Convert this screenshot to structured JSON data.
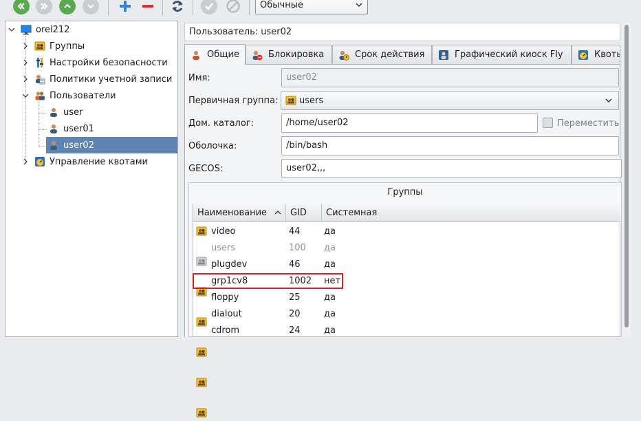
{
  "toolbar": {
    "view_mode": "Обычные",
    "icons": [
      "first-icon",
      "back-icon",
      "up-icon",
      "down-icon",
      "add-icon",
      "remove-icon",
      "refresh-icon",
      "apply-icon",
      "cancel-icon"
    ]
  },
  "tree": {
    "root": "orel212",
    "items": [
      {
        "label": "Группы",
        "icon": "group-icon"
      },
      {
        "label": "Настройки безопасности",
        "icon": "security-settings-icon"
      },
      {
        "label": "Политики учетной записи",
        "icon": "account-policy-icon"
      },
      {
        "label": "Пользователи",
        "icon": "users-icon"
      },
      {
        "label": "user",
        "icon": "user-icon"
      },
      {
        "label": "user01",
        "icon": "user-icon"
      },
      {
        "label": "user02",
        "icon": "user-icon"
      },
      {
        "label": "Управление квотами",
        "icon": "quota-icon"
      }
    ],
    "selected": "user02"
  },
  "header": {
    "user_title": "Пользователь: user02"
  },
  "tabs": [
    {
      "label": "Общие"
    },
    {
      "label": "Блокировка"
    },
    {
      "label": "Срок действия"
    },
    {
      "label": "Графический киоск Fly"
    },
    {
      "label": "Квоты"
    }
  ],
  "form": {
    "name_label": "Имя:",
    "name_value": "user02",
    "primary_group_label": "Первичная группа:",
    "primary_group_value": "users",
    "home_label": "Дом. каталог:",
    "home_value": "/home/user02",
    "move_label": "Переместить",
    "shell_label": "Оболочка:",
    "shell_value": "/bin/bash",
    "gecos_label": "GECOS:",
    "gecos_value": "user02,,,"
  },
  "groups": {
    "title": "Группы",
    "columns": [
      "Наименование",
      "GID",
      "Системная"
    ],
    "rows": [
      {
        "name": "video",
        "gid": "44",
        "system": "да"
      },
      {
        "name": "users",
        "gid": "100",
        "system": "да"
      },
      {
        "name": "plugdev",
        "gid": "46",
        "system": "да"
      },
      {
        "name": "grp1cv8",
        "gid": "1002",
        "system": "нет"
      },
      {
        "name": "floppy",
        "gid": "25",
        "system": "да"
      },
      {
        "name": "dialout",
        "gid": "20",
        "system": "да"
      },
      {
        "name": "cdrom",
        "gid": "24",
        "system": "да"
      }
    ]
  },
  "colors": {
    "selection": "#5f85b4",
    "highlight_border": "#d8201f",
    "add_icon": "#2f86d6",
    "remove_icon": "#d8352f",
    "nav_green": "#5aa84f"
  }
}
